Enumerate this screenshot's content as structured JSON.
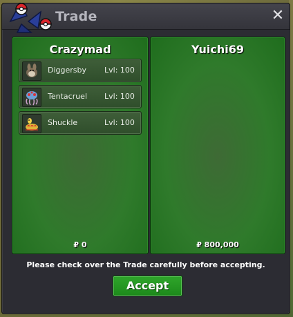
{
  "window": {
    "title": "Trade",
    "close_icon": "close-icon"
  },
  "left_panel": {
    "player_name": "Crazymad",
    "money": "₽ 0",
    "pokemon": [
      {
        "name": "Diggersby",
        "level": "Lvl: 100",
        "icon": "diggersby-sprite-icon"
      },
      {
        "name": "Tentacruel",
        "level": "Lvl: 100",
        "icon": "tentacruel-sprite-icon"
      },
      {
        "name": "Shuckle",
        "level": "Lvl: 100",
        "icon": "shuckle-sprite-icon"
      }
    ]
  },
  "right_panel": {
    "player_name": "Yuichi69",
    "money": "₽ 800,000",
    "pokemon": []
  },
  "footer": {
    "notice": "Please check over the Trade carefully before accepting.",
    "accept_label": "Accept"
  },
  "colors": {
    "panel_green": "#2f7a2b",
    "button_green": "#2fa52b",
    "window_bg": "#2c2c33",
    "title_text": "#b5b5bd"
  }
}
